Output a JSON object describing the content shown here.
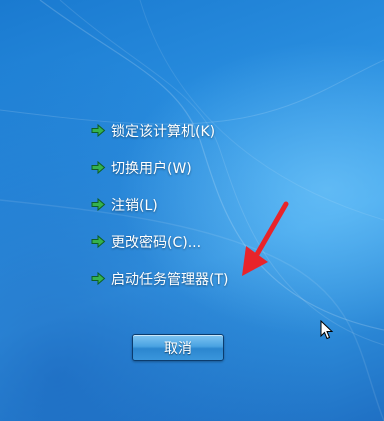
{
  "menu": {
    "items": [
      {
        "label": "锁定该计算机(K)",
        "icon": "green-arrow-icon"
      },
      {
        "label": "切换用户(W)",
        "icon": "green-arrow-icon"
      },
      {
        "label": "注销(L)",
        "icon": "green-arrow-icon"
      },
      {
        "label": "更改密码(C)...",
        "icon": "green-arrow-icon"
      },
      {
        "label": "启动任务管理器(T)",
        "icon": "green-arrow-icon"
      }
    ]
  },
  "cancel_button": {
    "label": "取消"
  },
  "annotation": {
    "color": "#e8242a",
    "icon": "red-pointer-arrow"
  },
  "colors": {
    "background": "#2a8fe0",
    "menu_text": "#ffffff",
    "arrow_green": "#2fa84a"
  }
}
